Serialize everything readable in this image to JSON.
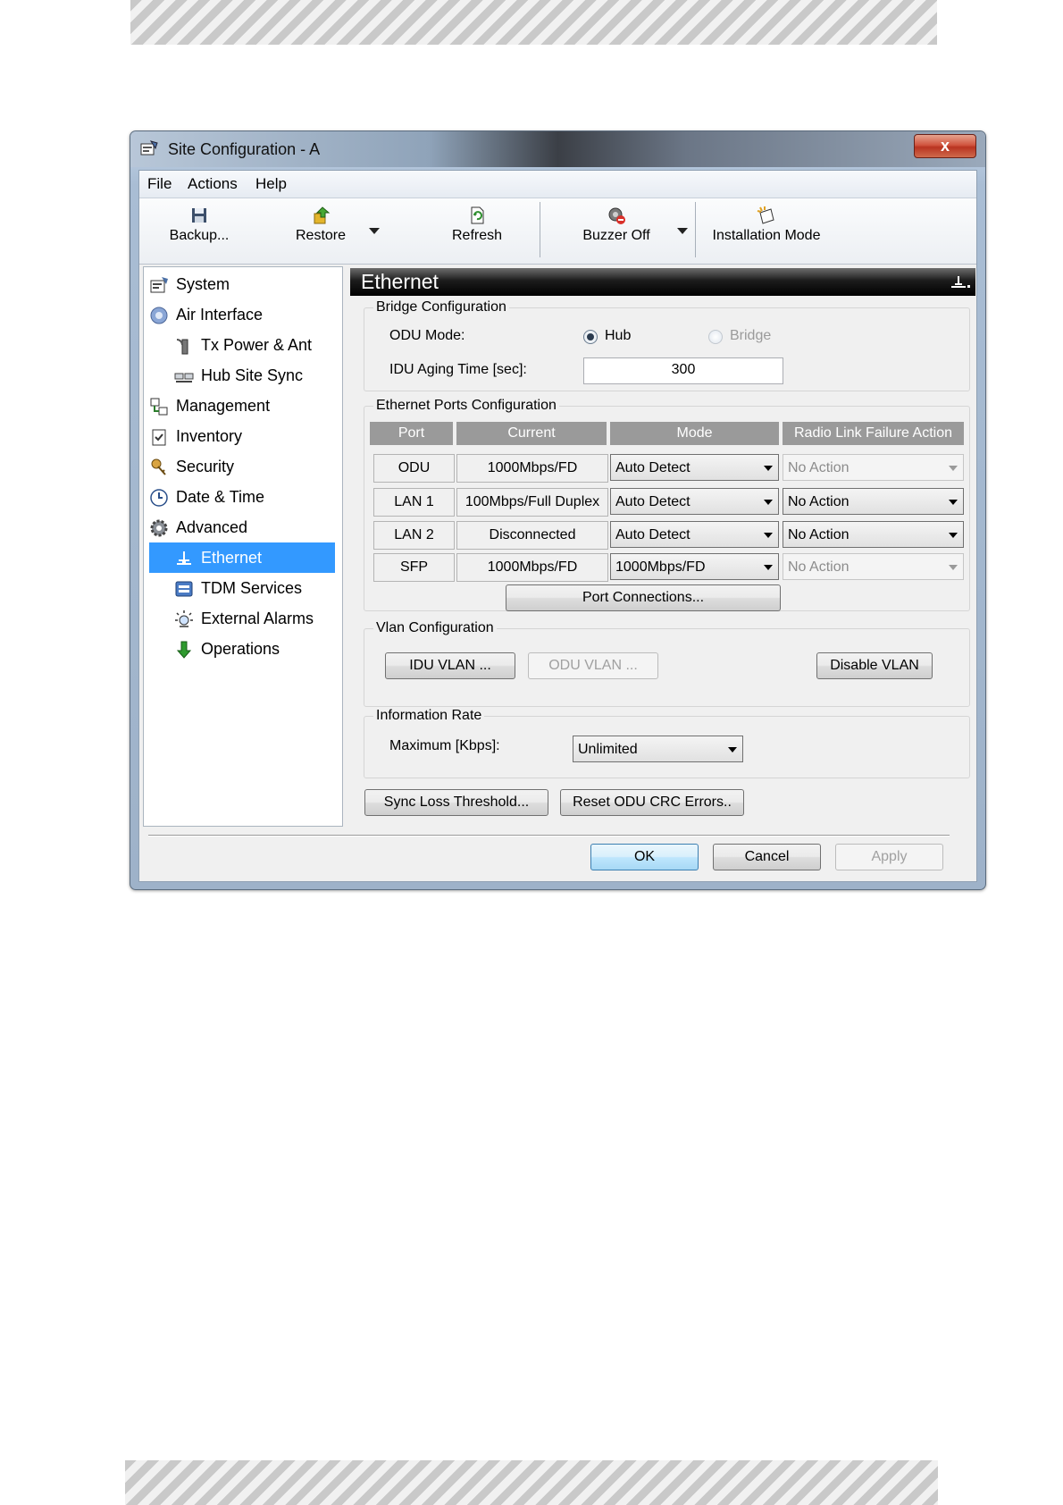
{
  "window": {
    "title": "Site Configuration - A",
    "close_glyph": "x"
  },
  "menu": [
    "File",
    "Actions",
    "Help"
  ],
  "toolbar": {
    "backup": "Backup...",
    "restore": "Restore",
    "refresh": "Refresh",
    "buzzer_off": "Buzzer Off",
    "installation_mode": "Installation Mode"
  },
  "nav": {
    "items": [
      {
        "label": "System",
        "icon": "system-icon"
      },
      {
        "label": "Air Interface",
        "icon": "air-interface-icon"
      },
      {
        "label": "Tx Power & Ant",
        "icon": "tx-power-icon"
      },
      {
        "label": "Hub Site Sync",
        "icon": "hub-site-sync-icon"
      },
      {
        "label": "Management",
        "icon": "management-icon"
      },
      {
        "label": "Inventory",
        "icon": "inventory-icon"
      },
      {
        "label": "Security",
        "icon": "security-icon"
      },
      {
        "label": "Date & Time",
        "icon": "clock-icon"
      },
      {
        "label": "Advanced",
        "icon": "gear-icon"
      },
      {
        "label": "Ethernet",
        "icon": "ethernet-icon"
      },
      {
        "label": "TDM Services",
        "icon": "tdm-icon"
      },
      {
        "label": "External Alarms",
        "icon": "alarm-icon"
      },
      {
        "label": "Operations",
        "icon": "operations-icon"
      }
    ],
    "selected": "Ethernet"
  },
  "panel": {
    "title": "Ethernet"
  },
  "bridge": {
    "group_label": "Bridge Configuration",
    "odu_mode_label": "ODU Mode:",
    "hub_label": "Hub",
    "bridge_label": "Bridge",
    "selected_mode": "Hub",
    "aging_label": "IDU Aging Time [sec]:",
    "aging_value": "300"
  },
  "ports": {
    "group_label": "Ethernet Ports Configuration",
    "headers": [
      "Port",
      "Current",
      "Mode",
      "Radio Link Failure Action"
    ],
    "rows": [
      {
        "port": "ODU",
        "current": "1000Mbps/FD",
        "mode": "Auto Detect",
        "action": "No Action"
      },
      {
        "port": "LAN 1",
        "current": "100Mbps/Full Duplex",
        "mode": "Auto Detect",
        "action": "No Action"
      },
      {
        "port": "LAN 2",
        "current": "Disconnected",
        "mode": "Auto Detect",
        "action": "No Action"
      },
      {
        "port": "SFP",
        "current": "1000Mbps/FD",
        "mode": "1000Mbps/FD",
        "action": "No Action"
      }
    ],
    "port_connections": "Port Connections..."
  },
  "vlan": {
    "group_label": "Vlan Configuration",
    "idu_vlan": "IDU VLAN ...",
    "odu_vlan": "ODU VLAN ...",
    "disable_vlan": "Disable VLAN"
  },
  "rate": {
    "group_label": "Information Rate",
    "max_label": "Maximum [Kbps]:",
    "max_value": "Unlimited"
  },
  "actions": {
    "sync_loss": "Sync Loss Threshold...",
    "reset_crc": "Reset ODU CRC Errors.."
  },
  "footer": {
    "ok": "OK",
    "cancel": "Cancel",
    "apply": "Apply"
  }
}
